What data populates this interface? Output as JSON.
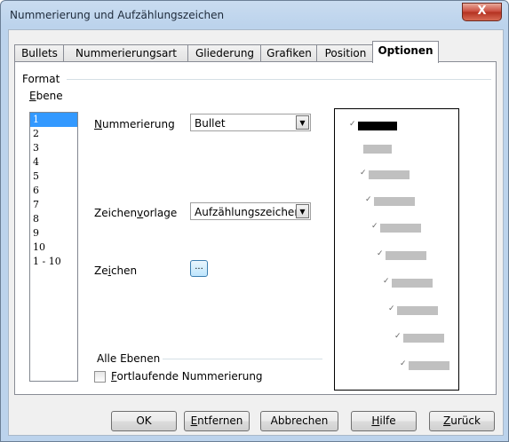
{
  "window": {
    "title": "Nummerierung und Aufzählungszeichen",
    "close_label": "X"
  },
  "tabs": [
    {
      "label": "Bullets"
    },
    {
      "label": "Nummerierungsart"
    },
    {
      "label": "Gliederung"
    },
    {
      "label": "Grafiken"
    },
    {
      "label": "Position"
    },
    {
      "label": "Optionen"
    }
  ],
  "format": {
    "group_label": "Format",
    "level_label": "Ebene",
    "levels": [
      "1",
      "2",
      "3",
      "4",
      "5",
      "6",
      "7",
      "8",
      "9",
      "10",
      "1 - 10"
    ],
    "selected_level": "1",
    "numbering_label": "Nummerierung",
    "numbering_value": "Bullet",
    "char_style_label": "Zeichenvorlage",
    "char_style_value": "Aufzählungszeichen",
    "character_label": "Zeichen",
    "character_button": "..."
  },
  "all_levels": {
    "group_label": "Alle Ebenen",
    "consecutive_label": "Fortlaufende Nummerierung",
    "consecutive_checked": false
  },
  "buttons": {
    "ok": "OK",
    "remove": "Entfernen",
    "cancel": "Abbrechen",
    "help": "Hilfe",
    "back": "Zurück"
  }
}
